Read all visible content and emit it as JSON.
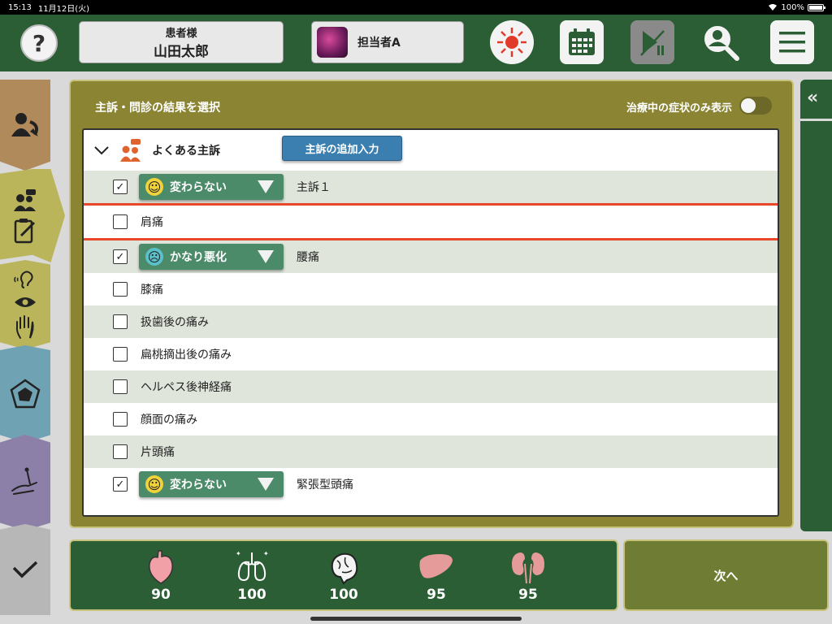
{
  "status_bar": {
    "time": "15:13",
    "date": "11月12日(火)",
    "battery": "100%",
    "battery_level": 1.0
  },
  "header": {
    "help_label": "?",
    "patient_label": "患者様",
    "patient_name": "山田太郎",
    "staff_name": "担当者A"
  },
  "panel": {
    "title": "主訴・問診の結果を選択",
    "toggle_label": "治療中の症状のみ表示",
    "toggle_on": false
  },
  "group": {
    "title": "よくある主訴",
    "add_button": "主訴の追加入力"
  },
  "rows": [
    {
      "checked": true,
      "check_mark": "✓",
      "status": "変わらない",
      "status_face": "happy",
      "label": "主訴１"
    },
    {
      "checked": false,
      "label": "肩痛",
      "selected": true
    },
    {
      "checked": true,
      "check_mark": "✓",
      "status": "かなり悪化",
      "status_face": "sad",
      "label": "腰痛"
    },
    {
      "checked": false,
      "label": "膝痛"
    },
    {
      "checked": false,
      "label": "扱歯後の痛み"
    },
    {
      "checked": false,
      "label": "扁桃摘出後の痛み"
    },
    {
      "checked": false,
      "label": "ヘルペス後神経痛"
    },
    {
      "checked": false,
      "label": "顔面の痛み"
    },
    {
      "checked": false,
      "label": "片頭痛"
    },
    {
      "checked": true,
      "check_mark": "✓",
      "status": "変わらない",
      "status_face": "happy",
      "label": "緊張型頭痛"
    }
  ],
  "organs": [
    {
      "icon": "heart-icon",
      "value": "90"
    },
    {
      "icon": "lungs-icon",
      "value": "100"
    },
    {
      "icon": "brain-icon",
      "value": "100"
    },
    {
      "icon": "liver-icon",
      "value": "95"
    },
    {
      "icon": "kidneys-icon",
      "value": "95"
    }
  ],
  "next_button": "次へ",
  "side_panel": {
    "expand_glyph": "«"
  },
  "colors": {
    "header_green": "#2b5e34",
    "panel_olive": "#8a8433",
    "highlight_red": "#e9472a",
    "status_green": "#4c8b6a",
    "add_blue": "#3a7fb0"
  }
}
